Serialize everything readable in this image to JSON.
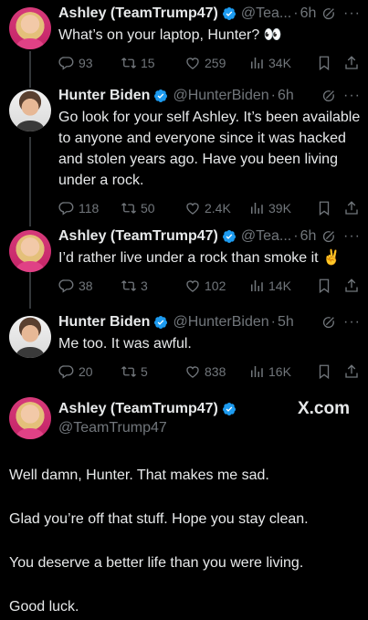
{
  "tweets": [
    {
      "name": "Ashley (TeamTrump47)",
      "handle": "@Tea...",
      "time": "6h",
      "text": "What’s on your laptop, Hunter? 👀",
      "replies": "93",
      "retweets": "15",
      "likes": "259",
      "views": "34K"
    },
    {
      "name": "Hunter Biden",
      "handle": "@HunterBiden",
      "time": "6h",
      "text": "Go look for your self Ashley. It’s been available to anyone and everyone since it was hacked and stolen years ago. Have you been living under a rock.",
      "replies": "118",
      "retweets": "50",
      "likes": "2.4K",
      "views": "39K"
    },
    {
      "name": "Ashley (TeamTrump47)",
      "handle": "@Tea...",
      "time": "6h",
      "text": "I’d rather live under a rock than smoke it ✌️",
      "replies": "38",
      "retweets": "3",
      "likes": "102",
      "views": "14K"
    },
    {
      "name": "Hunter Biden",
      "handle": "@HunterBiden",
      "time": "5h",
      "text": "Me too. It was awful.",
      "replies": "20",
      "retweets": "5",
      "likes": "838",
      "views": "16K"
    }
  ],
  "final": {
    "name": "Ashley (TeamTrump47)",
    "handle": "@TeamTrump47",
    "brand": "X.com",
    "paragraphs": [
      "Well damn, Hunter. That makes me sad.",
      "Glad you’re off that stuff. Hope you stay clean.",
      "You deserve a better life than you were living.",
      "Good luck."
    ]
  },
  "colors": {
    "background": "#000000",
    "text": "#e7e9ea",
    "muted": "#71767b",
    "verified": "#1d9bf0",
    "line": "#333639"
  },
  "icons": [
    "verified-badge-icon",
    "grok-icon",
    "more-icon",
    "reply-icon",
    "retweet-icon",
    "like-icon",
    "views-icon",
    "bookmark-icon",
    "share-icon"
  ]
}
